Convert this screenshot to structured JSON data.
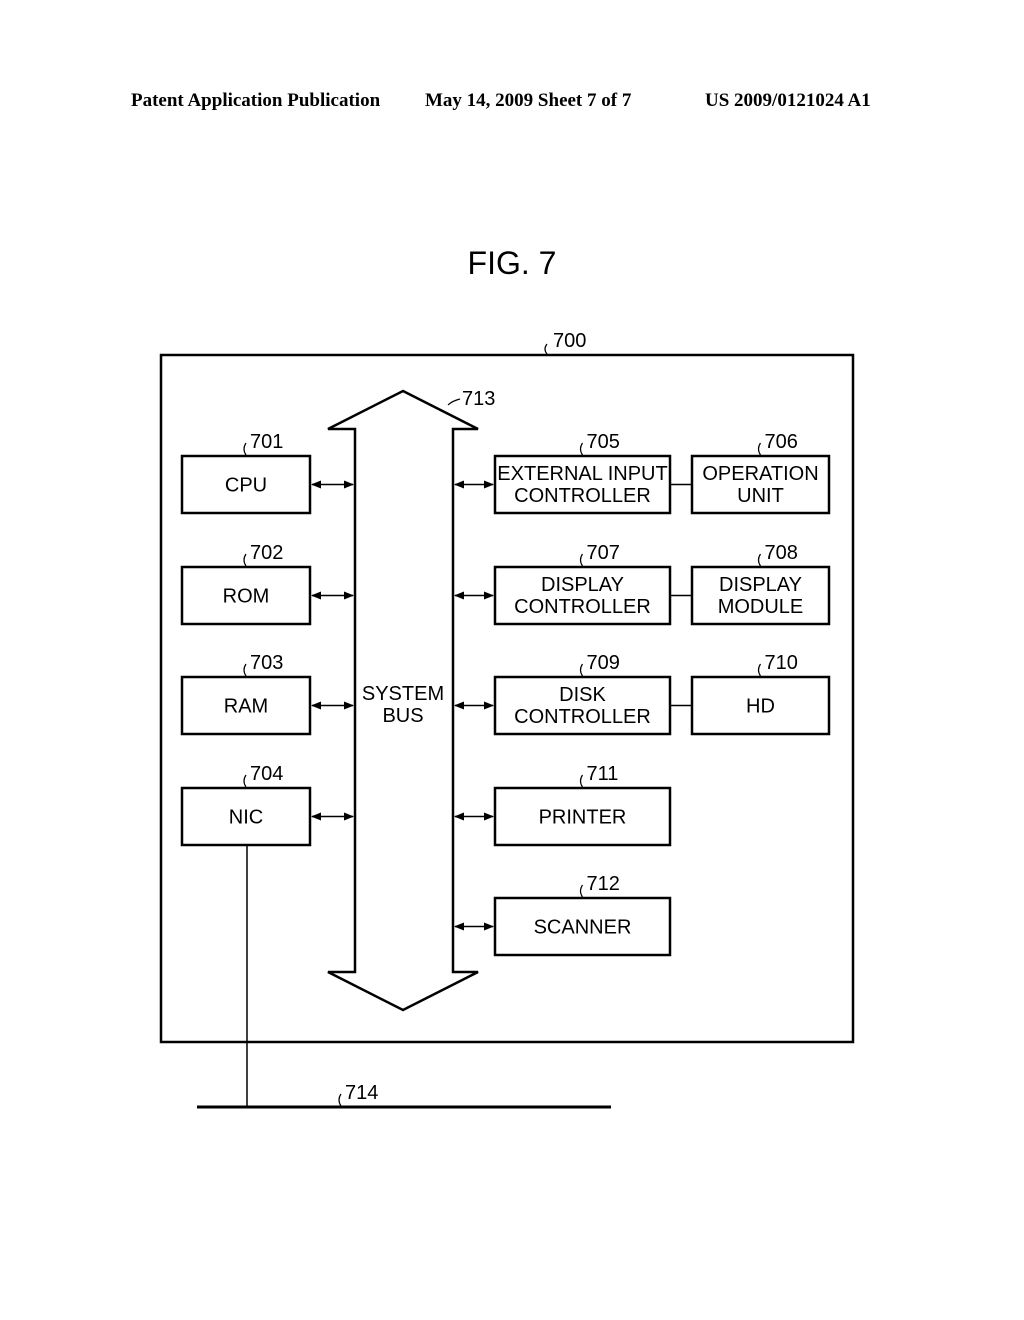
{
  "header": {
    "publication": "Patent Application Publication",
    "date_sheet": "May 14, 2009  Sheet 7 of 7",
    "number": "US 2009/0121024 A1"
  },
  "figure": {
    "title": "FIG. 7",
    "system_ref": "700",
    "bus": {
      "ref": "713",
      "line1": "SYSTEM",
      "line2": "BUS"
    },
    "network": {
      "ref": "714"
    },
    "left_blocks": [
      {
        "ref": "701",
        "line1": "CPU",
        "line2": ""
      },
      {
        "ref": "702",
        "line1": "ROM",
        "line2": ""
      },
      {
        "ref": "703",
        "line1": "RAM",
        "line2": ""
      },
      {
        "ref": "704",
        "line1": "NIC",
        "line2": ""
      }
    ],
    "right_blocks": [
      {
        "ref": "705",
        "line1": "EXTERNAL INPUT",
        "line2": "CONTROLLER"
      },
      {
        "ref": "707",
        "line1": "DISPLAY",
        "line2": "CONTROLLER"
      },
      {
        "ref": "709",
        "line1": "DISK",
        "line2": "CONTROLLER"
      },
      {
        "ref": "711",
        "line1": "PRINTER",
        "line2": ""
      },
      {
        "ref": "712",
        "line1": "SCANNER",
        "line2": ""
      }
    ],
    "device_blocks": [
      {
        "ref": "706",
        "line1": "OPERATION",
        "line2": "UNIT"
      },
      {
        "ref": "708",
        "line1": "DISPLAY",
        "line2": "MODULE"
      },
      {
        "ref": "710",
        "line1": "HD",
        "line2": ""
      }
    ]
  }
}
